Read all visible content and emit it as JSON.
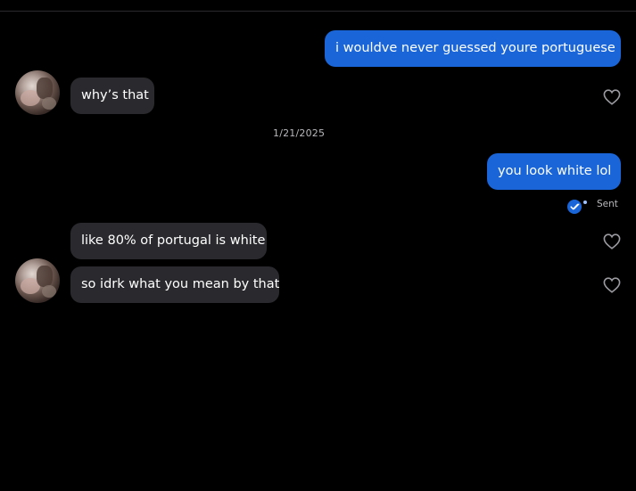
{
  "messages": {
    "m1": "i wouldve never guessed youre portuguese",
    "m2": "why’s that",
    "m3": "you look white lol",
    "m4": "like 80% of portugal is white",
    "m5": "so idrk what you mean by that"
  },
  "timestamp": "1/21/2025",
  "status": {
    "label": "Sent"
  },
  "colors": {
    "outgoing_bubble": "#1a66d9",
    "incoming_bubble": "#2a2a2e",
    "background": "#000000",
    "secondary_text": "#b9b9bd"
  },
  "icons": {
    "like": "heart-outline-icon",
    "status": "read-check-icon"
  }
}
